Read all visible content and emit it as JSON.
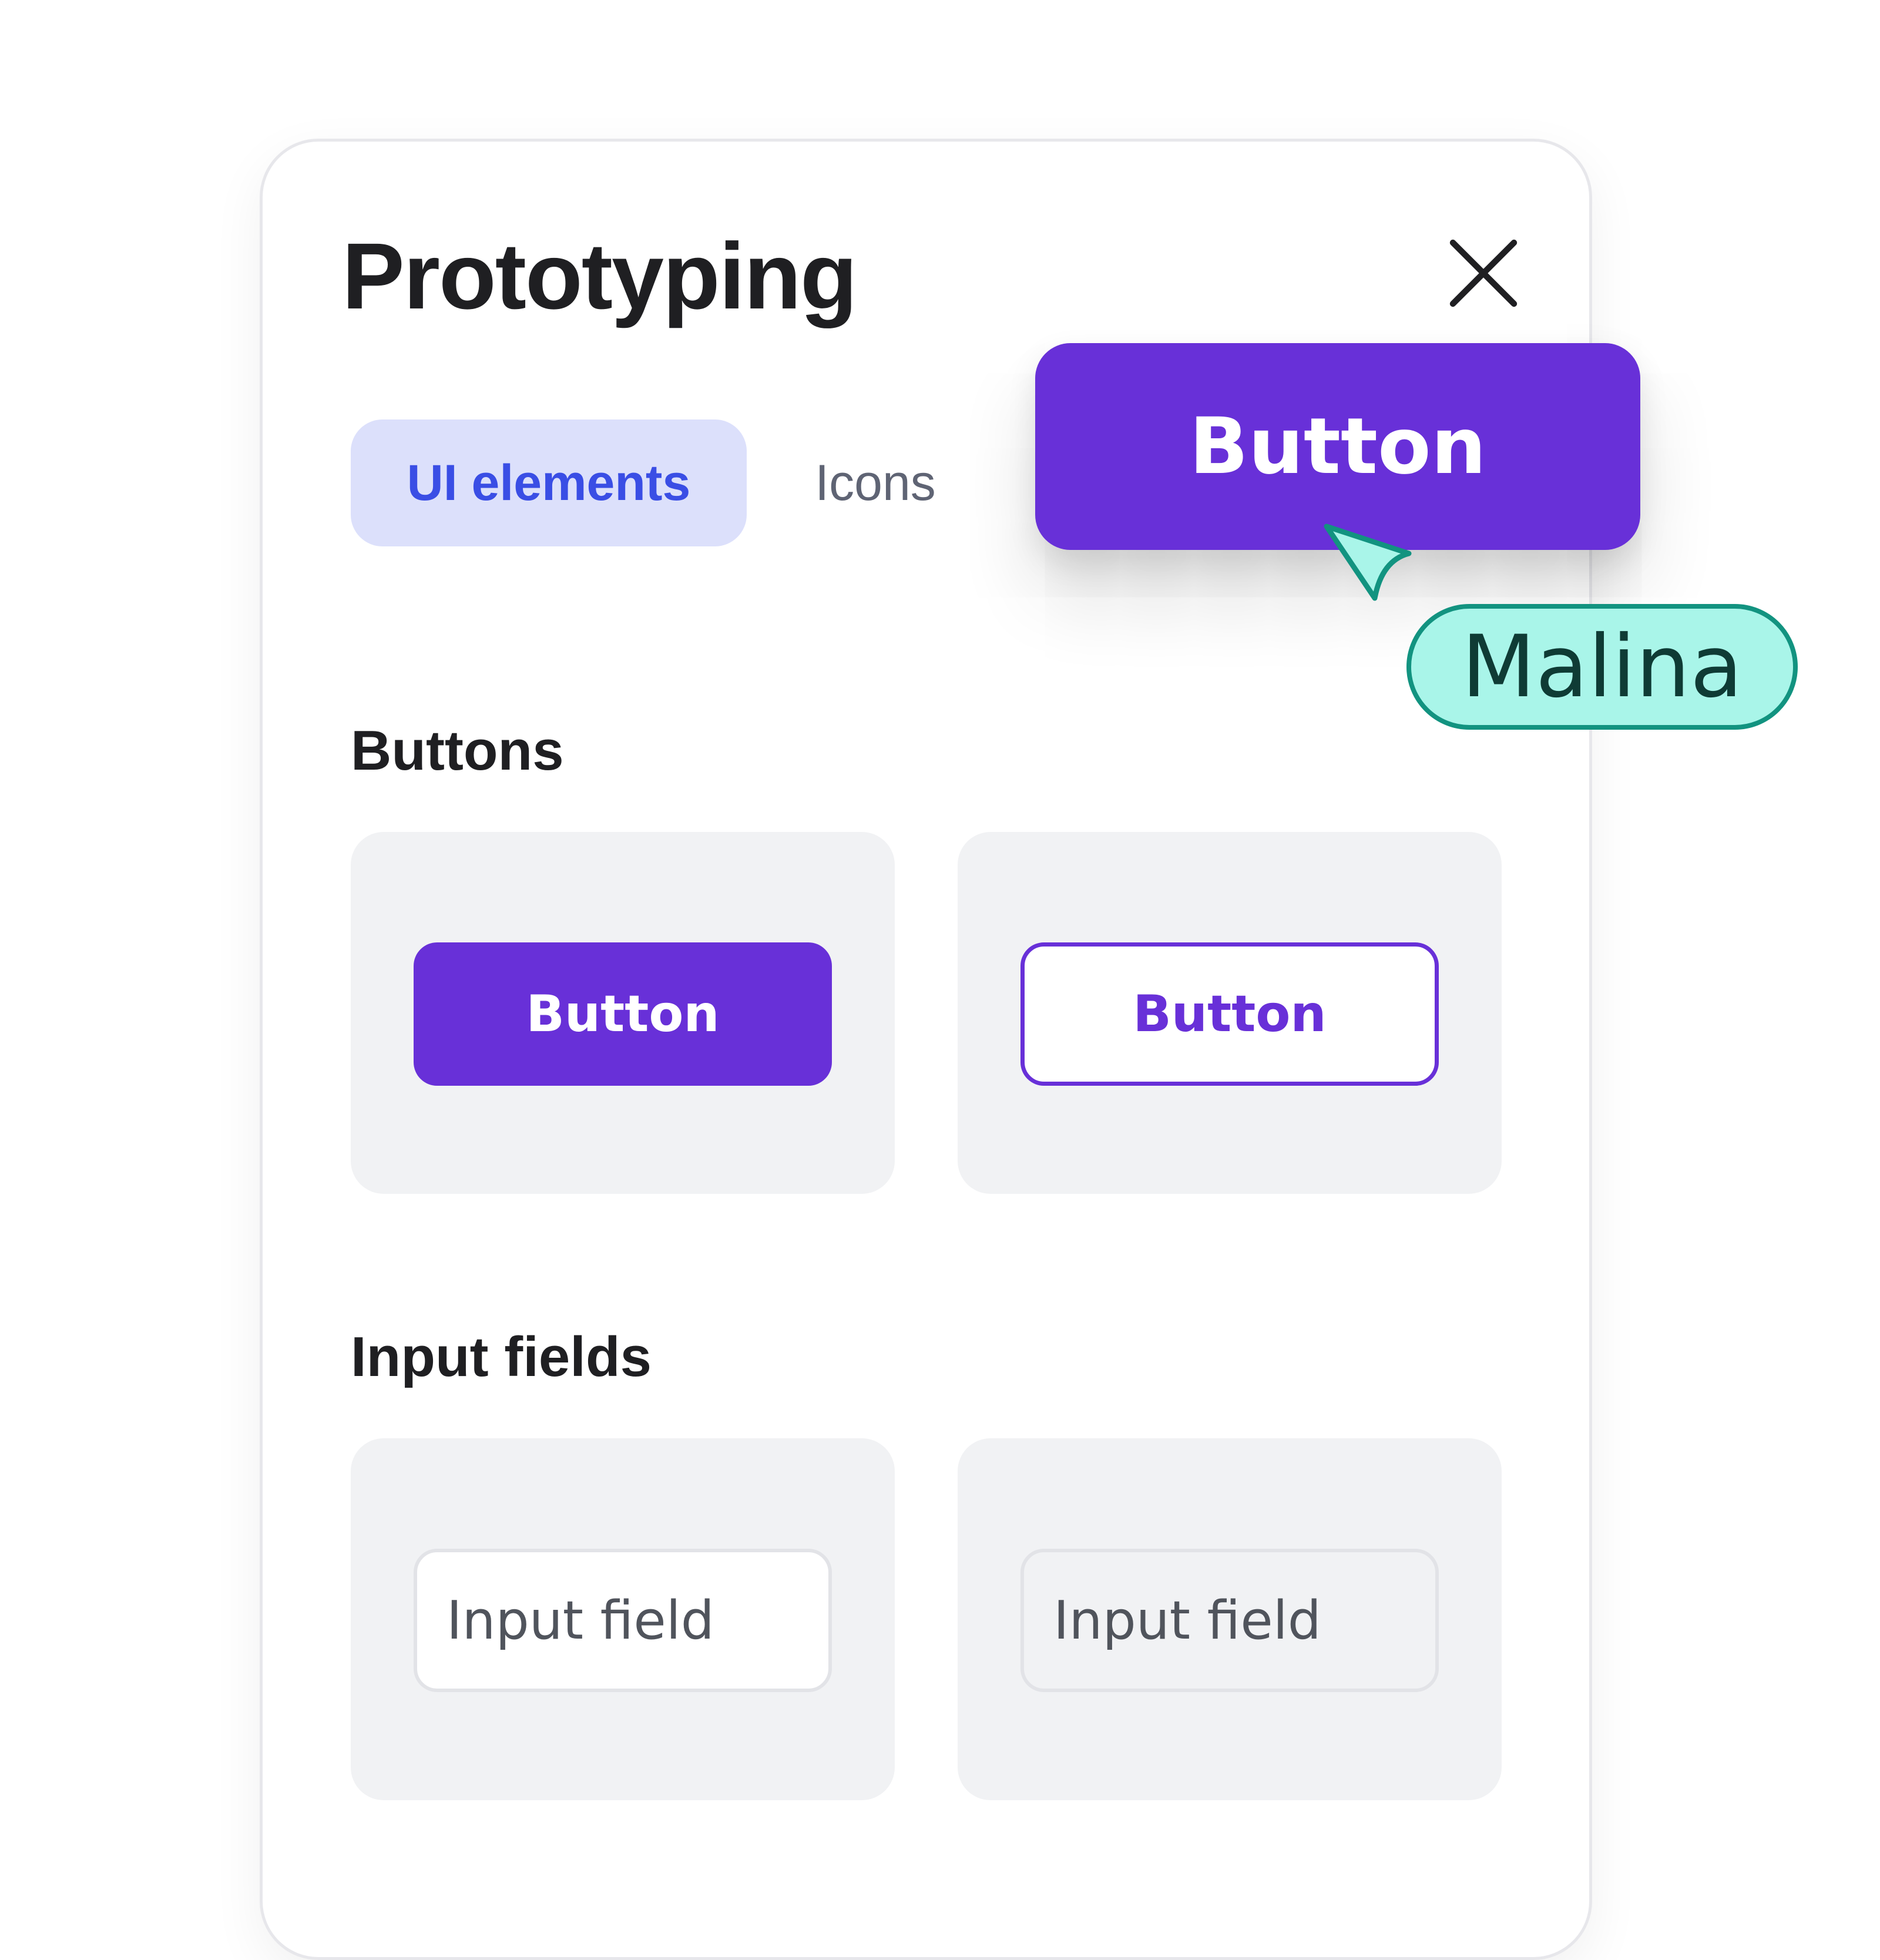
{
  "panel": {
    "title": "Prototyping",
    "close_icon": "close-icon"
  },
  "tabs": [
    {
      "label": "UI elements",
      "active": true
    },
    {
      "label": "Icons",
      "active": false
    }
  ],
  "sections": {
    "buttons": {
      "label": "Buttons",
      "filled_label": "Button",
      "outline_label": "Button"
    },
    "inputs": {
      "label": "Input fields",
      "white_placeholder": "Input field",
      "grey_placeholder": "Input field"
    }
  },
  "dragged_button": {
    "label": "Button"
  },
  "collaborator": {
    "name": "Malina",
    "icon": "cursor-arrow-icon"
  },
  "colors": {
    "primary": "#6830d8",
    "tab_active_bg": "#dce0fb",
    "tab_active_text": "#3a4ee5",
    "card_bg": "#f1f2f4",
    "collaborator_fill": "#a9f5e9",
    "collaborator_stroke": "#129380"
  }
}
